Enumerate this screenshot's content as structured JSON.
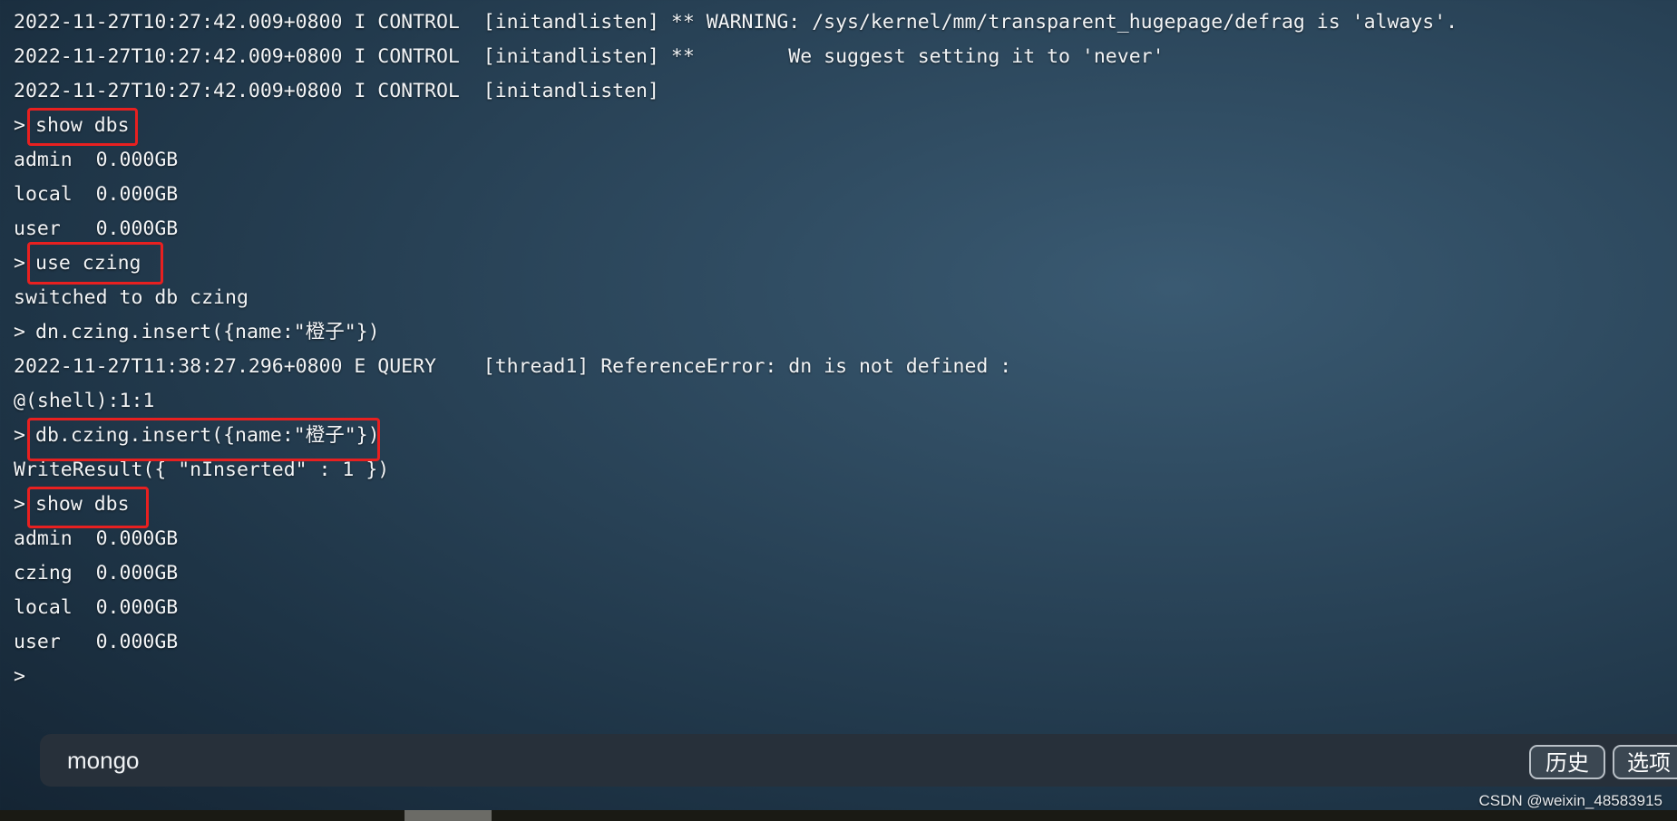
{
  "terminal": {
    "lines": [
      "2022-11-27T10:27:42.009+0800 I CONTROL  [initandlisten] ** WARNING: /sys/kernel/mm/transparent_hugepage/defrag is 'always'.",
      "2022-11-27T10:27:42.009+0800 I CONTROL  [initandlisten] **        We suggest setting it to 'never'",
      "2022-11-27T10:27:42.009+0800 I CONTROL  [initandlisten]",
      "show dbs",
      "admin  0.000GB",
      "local  0.000GB",
      "user   0.000GB",
      "use czing",
      "switched to db czing",
      "dn.czing.insert({name:\"橙子\"})",
      "2022-11-27T11:38:27.296+0800 E QUERY    [thread1] ReferenceError: dn is not defined :",
      "@(shell):1:1",
      "db.czing.insert({name:\"橙子\"})",
      "WriteResult({ \"nInserted\" : 1 })",
      "show dbs",
      "admin  0.000GB",
      "czing  0.000GB",
      "local  0.000GB",
      "user   0.000GB",
      ""
    ],
    "prompt": ">"
  },
  "input_bar": {
    "text": "mongo"
  },
  "buttons": {
    "history": "历史",
    "options": "选项"
  },
  "watermark": "CSDN @weixin_48583915",
  "colors": {
    "highlight": "#e82020",
    "text": "#f2f4f6"
  }
}
